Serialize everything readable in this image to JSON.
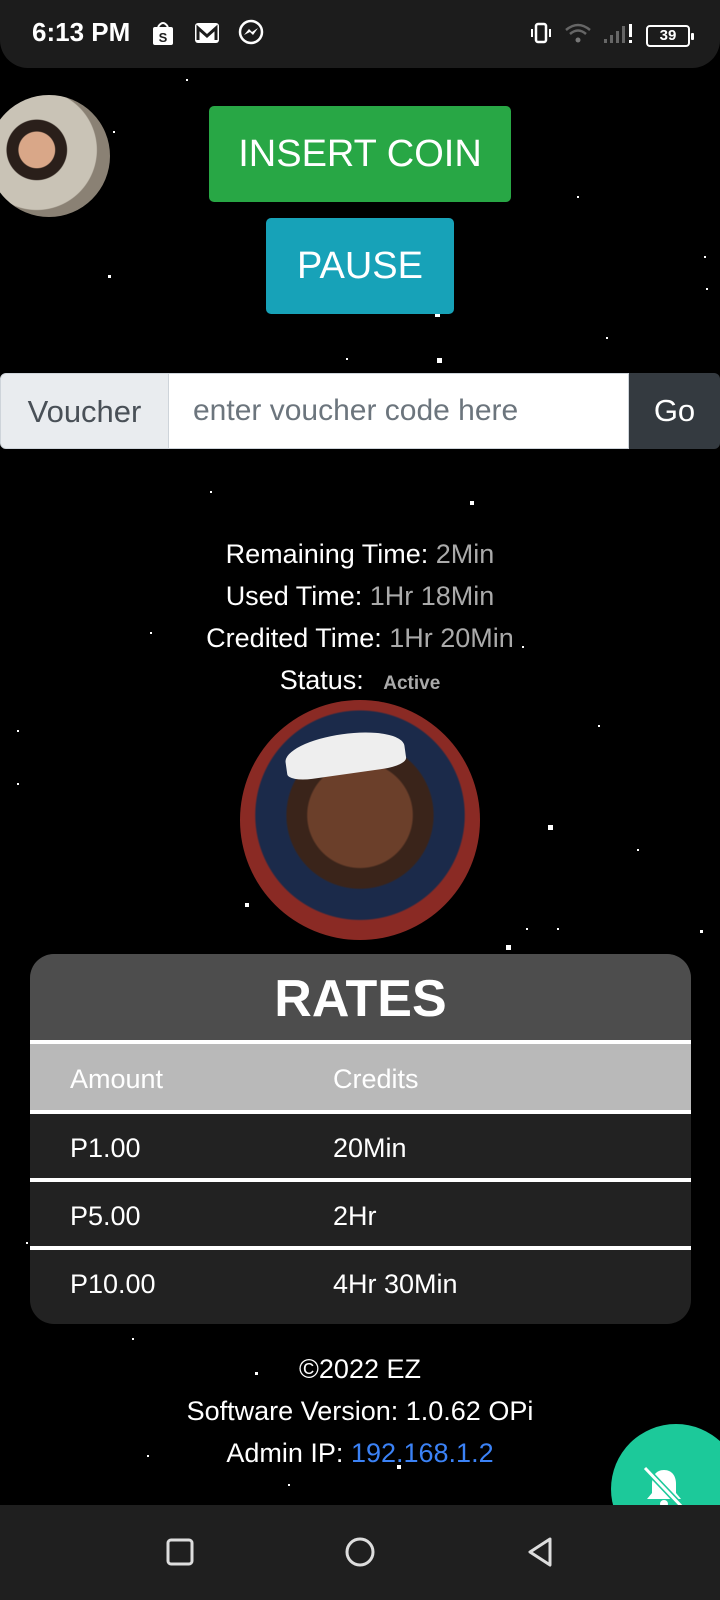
{
  "status_bar": {
    "time": "6:13 PM",
    "battery": "39",
    "icons": [
      "shopee-icon",
      "gmail-icon",
      "messenger-icon",
      "vibrate-icon",
      "wifi-icon",
      "signal-icon",
      "battery-icon"
    ]
  },
  "buttons": {
    "insert_coin": "INSERT COIN",
    "pause": "PAUSE"
  },
  "voucher": {
    "label": "Voucher",
    "placeholder": "enter voucher code here",
    "go": "Go"
  },
  "session": {
    "remaining_label": "Remaining Time:",
    "remaining_value": "2Min",
    "used_label": "Used Time:",
    "used_value": "1Hr 18Min",
    "credited_label": "Credited Time:",
    "credited_value": "1Hr 20Min",
    "status_label": "Status:",
    "status_value": "Active"
  },
  "rates": {
    "title": "RATES",
    "headers": [
      "Amount",
      "Credits"
    ],
    "rows": [
      {
        "amount": "P1.00",
        "credits": "20Min"
      },
      {
        "amount": "P5.00",
        "credits": "2Hr"
      },
      {
        "amount": "P10.00",
        "credits": "4Hr 30Min"
      }
    ]
  },
  "footer": {
    "copyright": "©2022 EZ",
    "version": "Software Version: 1.0.62 OPi",
    "admin_label": "Admin IP:",
    "admin_ip": "192.168.1.2"
  },
  "colors": {
    "insert_coin": "#28a745",
    "pause": "#17a2b8",
    "fab": "#1cc99a",
    "link": "#3b82f6"
  }
}
